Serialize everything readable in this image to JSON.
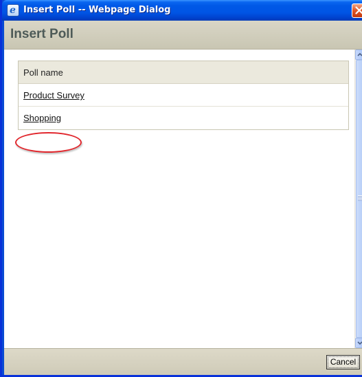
{
  "window": {
    "title": "Insert Poll -- Webpage Dialog"
  },
  "header": {
    "title": "Insert Poll"
  },
  "table": {
    "column_header": "Poll name",
    "rows": [
      {
        "name": "Product Survey"
      },
      {
        "name": "Shopping"
      }
    ]
  },
  "footer": {
    "cancel_label": "Cancel"
  },
  "icons": {
    "window_icon": "ie-icon",
    "close": "close-icon"
  },
  "colors": {
    "titlebar": "#0055e5",
    "header_bg": "#d2cfbd",
    "header_text": "#4e5b58",
    "highlight": "#e1262c"
  }
}
